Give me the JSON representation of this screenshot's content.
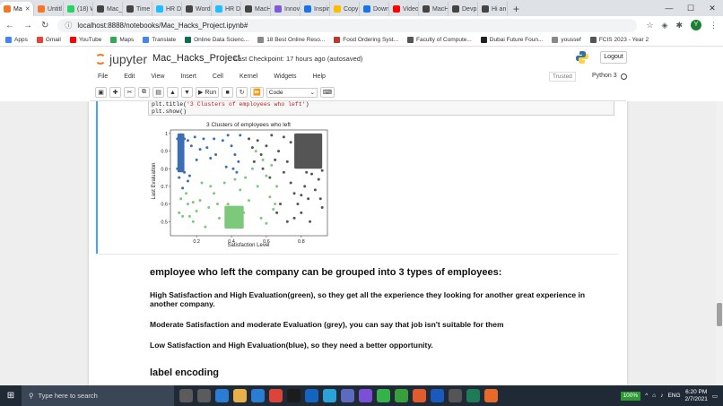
{
  "browser": {
    "tabs": [
      {
        "label": "Ma",
        "color": "#f37726"
      },
      {
        "label": "Untitl",
        "color": "#f37726"
      },
      {
        "label": "(18) W",
        "color": "#25d366"
      },
      {
        "label": "Mac_H",
        "color": "#444444"
      },
      {
        "label": "Time C",
        "color": "#444444"
      },
      {
        "label": "HR Da",
        "color": "#20beff"
      },
      {
        "label": "Word",
        "color": "#444444"
      },
      {
        "label": "HR Da",
        "color": "#20beff"
      },
      {
        "label": "MacH",
        "color": "#444444"
      },
      {
        "label": "Innov",
        "color": "#7b5bd6"
      },
      {
        "label": "Inspira",
        "color": "#1a73e8"
      },
      {
        "label": "Copy c",
        "color": "#fbbc04"
      },
      {
        "label": "Downl",
        "color": "#1a73e8"
      },
      {
        "label": "Video",
        "color": "#ff0000"
      },
      {
        "label": "MacH",
        "color": "#444444"
      },
      {
        "label": "Devp",
        "color": "#444444"
      },
      {
        "label": "Hi an",
        "color": "#444444"
      }
    ],
    "url": "localhost:8888/notebooks/Mac_Hacks_Project.ipynb#",
    "bookmarks": [
      {
        "label": "Apps",
        "color": "#4285f4"
      },
      {
        "label": "Gmail",
        "color": "#ea4335"
      },
      {
        "label": "YouTube",
        "color": "#ff0000"
      },
      {
        "label": "Maps",
        "color": "#34a853"
      },
      {
        "label": "Translate",
        "color": "#4285f4"
      },
      {
        "label": "Online Data Scienc...",
        "color": "#0b6e4f"
      },
      {
        "label": "18 Best Online Reso...",
        "color": "#888888"
      },
      {
        "label": "Food Ordering Syst...",
        "color": "#c0392b"
      },
      {
        "label": "Faculty of Compute...",
        "color": "#555555"
      },
      {
        "label": "Dubai Future Foun...",
        "color": "#222222"
      },
      {
        "label": "youssef",
        "color": "#888888"
      },
      {
        "label": "FCIS 2023 - Year 2",
        "color": "#555555"
      }
    ],
    "avatar": "Y"
  },
  "jupyter": {
    "logo": "jupyter",
    "notebook_name": "Mac_Hacks_Project",
    "checkpoint": "Last Checkpoint: 17 hours ago  (autosaved)",
    "logout": "Logout",
    "menu": [
      "File",
      "Edit",
      "View",
      "Insert",
      "Cell",
      "Kernel",
      "Widgets",
      "Help"
    ],
    "trusted": "Trusted",
    "kernel": "Python 3",
    "toolbar": {
      "run": "Run",
      "cell_type": "Code"
    }
  },
  "cell": {
    "code_line1_pre": "plt.title(",
    "code_line1_str": "'3 Clusters of employees who left'",
    "code_line1_post": ")",
    "code_line2": "plt.show()"
  },
  "chart_data": {
    "type": "scatter",
    "title": "3 Clusters of employees who left",
    "xlabel": "Satisfaction Level",
    "ylabel": "Last Evaluation",
    "xlim": [
      0.05,
      0.95
    ],
    "ylim": [
      0.42,
      1.02
    ],
    "xticks": [
      0.2,
      0.4,
      0.6,
      0.8
    ],
    "yticks": [
      0.5,
      0.6,
      0.7,
      0.8,
      0.9,
      1.0
    ],
    "series": [
      {
        "color": "#3a6fb5",
        "points": [
          [
            0.09,
            0.97
          ],
          [
            0.1,
            0.93
          ],
          [
            0.1,
            0.88
          ],
          [
            0.11,
            0.84
          ],
          [
            0.09,
            0.8
          ],
          [
            0.11,
            0.95
          ],
          [
            0.12,
            0.9
          ],
          [
            0.1,
            0.86
          ],
          [
            0.12,
            0.82
          ],
          [
            0.13,
            0.97
          ],
          [
            0.15,
            0.96
          ],
          [
            0.17,
            0.93
          ],
          [
            0.22,
            0.91
          ],
          [
            0.24,
            0.97
          ],
          [
            0.26,
            0.92
          ],
          [
            0.28,
            0.86
          ],
          [
            0.35,
            0.96
          ],
          [
            0.38,
            0.99
          ],
          [
            0.4,
            0.93
          ],
          [
            0.42,
            0.88
          ],
          [
            0.44,
            0.84
          ],
          [
            0.41,
            0.8
          ],
          [
            0.15,
            0.73
          ],
          [
            0.12,
            0.69
          ],
          [
            0.16,
            0.76
          ],
          [
            0.2,
            0.85
          ],
          [
            0.31,
            0.88
          ],
          [
            0.43,
            0.78
          ],
          [
            0.37,
            0.81
          ],
          [
            0.45,
            0.99
          ],
          [
            0.13,
            0.78
          ],
          [
            0.19,
            0.98
          ],
          [
            0.1,
            0.75
          ],
          [
            0.3,
            0.97
          ]
        ],
        "blob": [
          [
            0.09,
            1.0
          ],
          [
            0.13,
            0.78
          ]
        ]
      },
      {
        "color": "#7cc97c",
        "points": [
          [
            0.1,
            0.55
          ],
          [
            0.12,
            0.53
          ],
          [
            0.15,
            0.6
          ],
          [
            0.18,
            0.5
          ],
          [
            0.2,
            0.56
          ],
          [
            0.22,
            0.62
          ],
          [
            0.25,
            0.47
          ],
          [
            0.27,
            0.58
          ],
          [
            0.3,
            0.66
          ],
          [
            0.33,
            0.52
          ],
          [
            0.36,
            0.72
          ],
          [
            0.38,
            0.6
          ],
          [
            0.45,
            0.68
          ],
          [
            0.48,
            0.75
          ],
          [
            0.5,
            0.62
          ],
          [
            0.52,
            0.8
          ],
          [
            0.55,
            0.7
          ],
          [
            0.57,
            0.52
          ],
          [
            0.6,
            0.76
          ],
          [
            0.62,
            0.64
          ],
          [
            0.64,
            0.57
          ],
          [
            0.58,
            0.85
          ],
          [
            0.54,
            0.9
          ],
          [
            0.66,
            0.7
          ],
          [
            0.14,
            0.66
          ],
          [
            0.18,
            0.61
          ],
          [
            0.23,
            0.72
          ],
          [
            0.28,
            0.7
          ],
          [
            0.32,
            0.6
          ],
          [
            0.42,
            0.74
          ],
          [
            0.47,
            0.55
          ],
          [
            0.6,
            0.49
          ],
          [
            0.63,
            0.82
          ],
          [
            0.65,
            0.6
          ],
          [
            0.11,
            0.63
          ],
          [
            0.16,
            0.53
          ]
        ],
        "blob": [
          [
            0.36,
            0.59
          ],
          [
            0.47,
            0.46
          ]
        ]
      },
      {
        "color": "#555555",
        "points": [
          [
            0.5,
            0.97
          ],
          [
            0.52,
            0.92
          ],
          [
            0.55,
            0.96
          ],
          [
            0.57,
            0.88
          ],
          [
            0.6,
            0.93
          ],
          [
            0.63,
            0.99
          ],
          [
            0.65,
            0.85
          ],
          [
            0.67,
            0.9
          ],
          [
            0.7,
            0.78
          ],
          [
            0.72,
            0.84
          ],
          [
            0.74,
            0.72
          ],
          [
            0.76,
            0.66
          ],
          [
            0.78,
            0.6
          ],
          [
            0.8,
            0.55
          ],
          [
            0.82,
            0.7
          ],
          [
            0.84,
            0.63
          ],
          [
            0.86,
            0.77
          ],
          [
            0.88,
            0.68
          ],
          [
            0.9,
            0.74
          ],
          [
            0.92,
            0.58
          ],
          [
            0.68,
            0.6
          ],
          [
            0.66,
            0.55
          ],
          [
            0.72,
            0.5
          ],
          [
            0.85,
            0.5
          ],
          [
            0.62,
            0.75
          ],
          [
            0.58,
            0.8
          ],
          [
            0.53,
            0.84
          ],
          [
            0.7,
            0.98
          ],
          [
            0.74,
            0.95
          ],
          [
            0.88,
            0.82
          ],
          [
            0.92,
            0.79
          ],
          [
            0.76,
            0.52
          ],
          [
            0.8,
            0.65
          ],
          [
            0.91,
            0.63
          ],
          [
            0.83,
            0.78
          ]
        ],
        "blob": [
          [
            0.76,
            1.0
          ],
          [
            0.92,
            0.8
          ]
        ]
      }
    ]
  },
  "markdown": {
    "heading": "employee who left the company can be grouped into 3 types of employees:",
    "para1": "High Satisfaction and High Evaluation(green), so they get all the experience they looking for another great experience in another company.",
    "para2": "Moderate Satisfaction and moderate Evaluation (grey), you can say that job isn't suitable for them",
    "para3": "Low Satisfaction and High Evaluation(blue), so they need a better opportunity.",
    "heading2": "label encoding"
  },
  "taskbar": {
    "search_placeholder": "Type here to search",
    "apps": [
      "#5b5b5b",
      "#5b5b5b",
      "#2b7cd3",
      "#e8b04b",
      "#2b7cd3",
      "#db4437",
      "#1c1c1c",
      "#1565c0",
      "#2aa4d8",
      "#5c6bc0",
      "#7b4fd6",
      "#33b34a",
      "#37a03d",
      "#e05b2e",
      "#185abd",
      "#555555",
      "#1e7b55",
      "#e86a2b"
    ],
    "zoom": "100%",
    "lang": "ENG",
    "time": "6:20 PM",
    "date": "2/7/2021"
  }
}
